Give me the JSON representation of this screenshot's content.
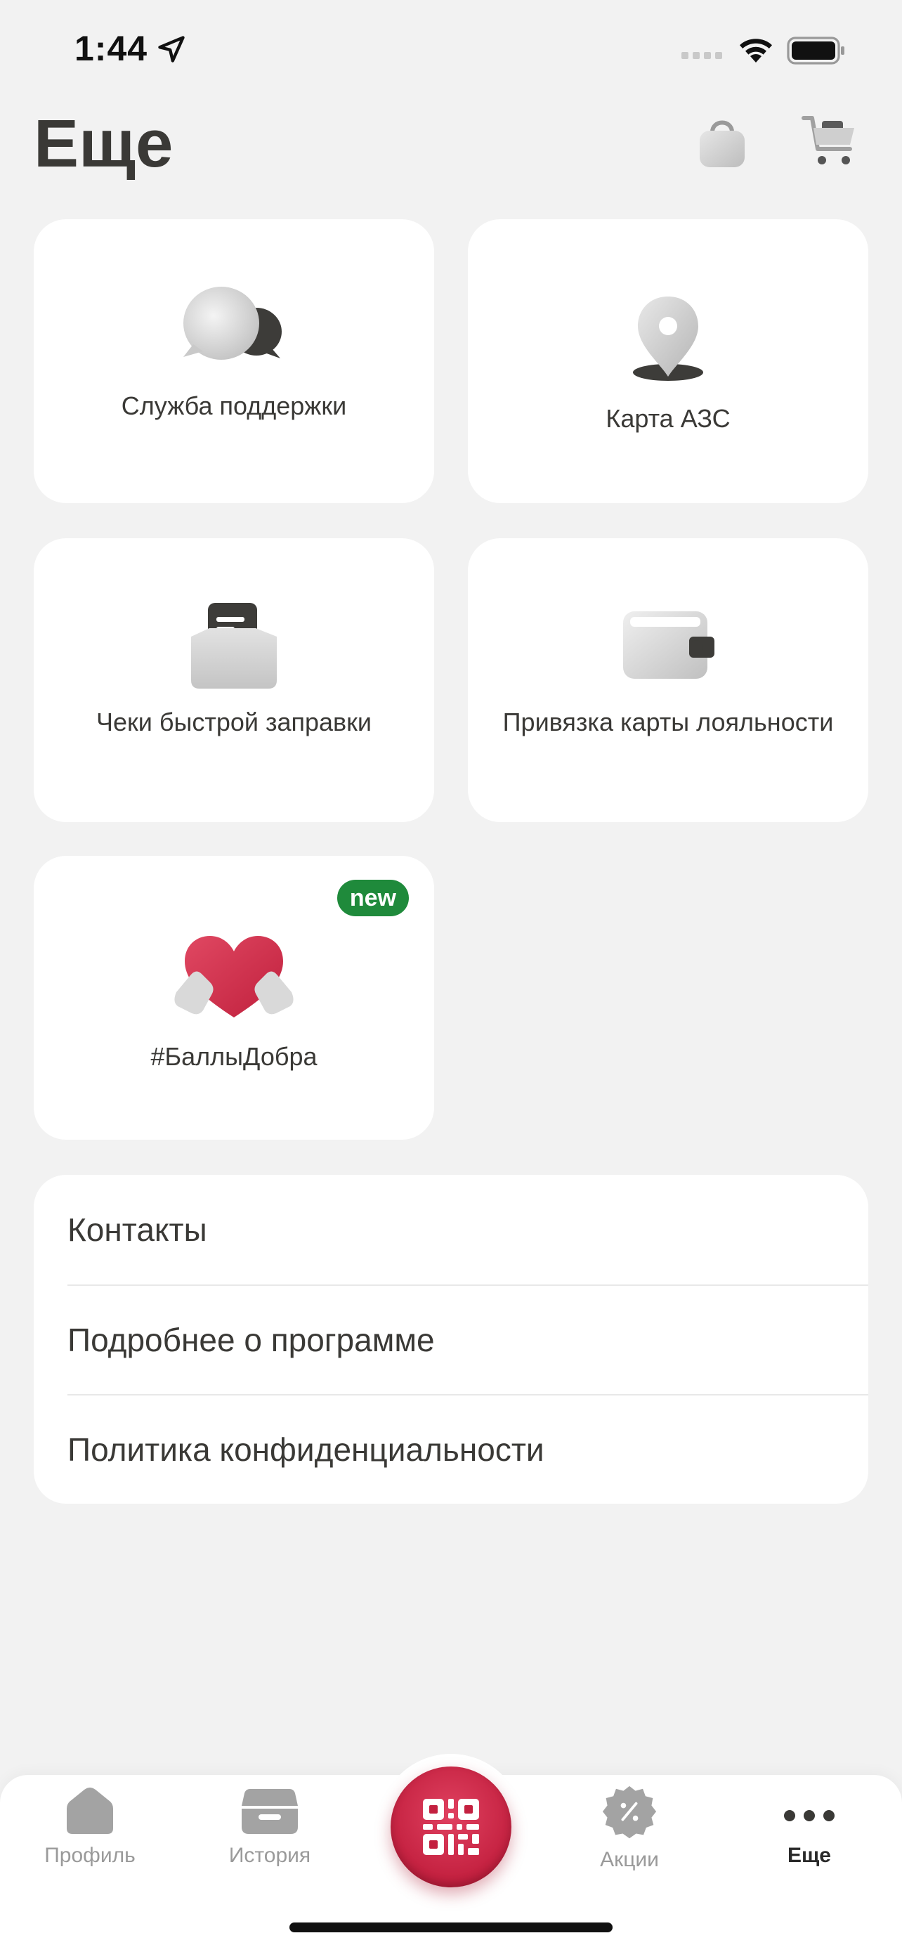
{
  "status_bar": {
    "time": "1:44"
  },
  "header": {
    "title": "Еще"
  },
  "tiles": [
    {
      "label": "Служба поддержки"
    },
    {
      "label": "Карта АЗС"
    },
    {
      "label": "Чеки быстрой заправки"
    },
    {
      "label": "Привязка карты лояльности"
    },
    {
      "label": "#БаллыДобра",
      "badge": "new"
    }
  ],
  "list": [
    {
      "label": "Контакты"
    },
    {
      "label": "Подробнее о программе"
    },
    {
      "label": "Политика конфиденциальности"
    }
  ],
  "tab_bar": {
    "profile": "Профиль",
    "history": "История",
    "promo": "Акции",
    "more": "Еще"
  },
  "colors": {
    "accent": "#c3203f",
    "badge_green": "#1f8a3b",
    "background": "#f2f2f2",
    "text": "#3a3936"
  },
  "icons": {
    "header": [
      "bag-icon",
      "cart-icon"
    ],
    "tiles": [
      "chat-bubbles-icon",
      "map-pin-icon",
      "receipt-icon",
      "wallet-icon",
      "heart-hands-icon"
    ],
    "tabs": [
      "home-icon",
      "box-icon",
      "qr-code-icon",
      "percent-badge-icon",
      "dots-icon"
    ]
  }
}
